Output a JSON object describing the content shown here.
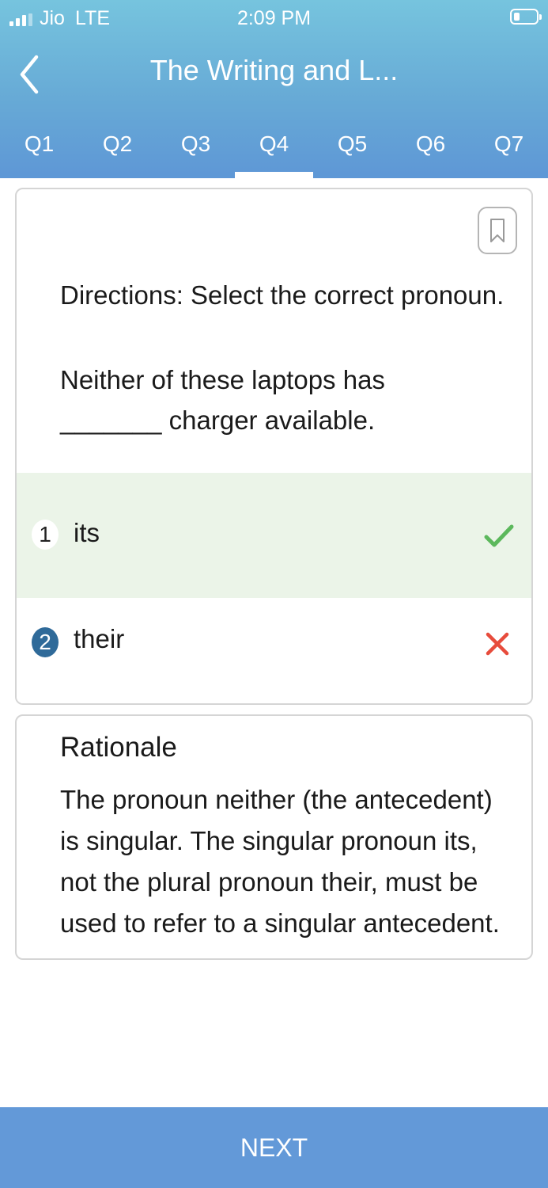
{
  "status_bar": {
    "carrier": "Jio",
    "network": "LTE",
    "time": "2:09 PM"
  },
  "header": {
    "title": "The Writing and L...",
    "back_icon": "chevron-left-icon"
  },
  "tabs": [
    {
      "label": "Q1",
      "active": false
    },
    {
      "label": "Q2",
      "active": false
    },
    {
      "label": "Q3",
      "active": false
    },
    {
      "label": "Q4",
      "active": true
    },
    {
      "label": "Q5",
      "active": false
    },
    {
      "label": "Q6",
      "active": false
    },
    {
      "label": "Q7",
      "active": false
    }
  ],
  "question": {
    "bookmark_icon": "bookmark-icon",
    "directions": "Directions: Select the correct pronoun.",
    "text": "Neither of these laptops has _______ charger available.",
    "options": [
      {
        "number": "1",
        "label": "its",
        "result": "correct",
        "result_icon": "checkmark-icon",
        "result_color": "#5cb85c"
      },
      {
        "number": "2",
        "label": "their",
        "result": "incorrect",
        "result_icon": "x-icon",
        "result_color": "#e74c3c"
      }
    ]
  },
  "rationale": {
    "title": "Rationale",
    "text": "The pronoun neither (the antecedent) is singular. The singular pronoun its, not the plural pronoun their, must be used to refer to a singular antecedent."
  },
  "footer": {
    "next_label": "NEXT"
  },
  "colors": {
    "header_top": "#76c4de",
    "header_bottom": "#5e97d6",
    "footer": "#6399d8",
    "correct_bg": "#ebf4e8",
    "selected_number_bg": "#2f6a99"
  }
}
